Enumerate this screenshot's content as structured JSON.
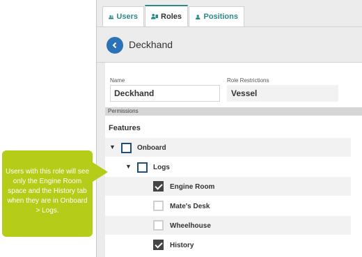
{
  "tabs": [
    {
      "label": "Users",
      "icon": "users-icon"
    },
    {
      "label": "Roles",
      "icon": "roles-icon"
    },
    {
      "label": "Positions",
      "icon": "person-icon"
    }
  ],
  "active_tab": "Roles",
  "header": {
    "title": "Deckhand",
    "back_icon": "chevron-left-icon"
  },
  "form": {
    "name_label": "Name",
    "name_value": "Deckhand",
    "role_restrictions_label": "Role Restrictions",
    "role_restrictions_value": "Vessel"
  },
  "permissions_label": "Permissions",
  "features_label": "Features",
  "tree": [
    {
      "label": "Onboard",
      "level": 0,
      "expanded": true,
      "checked": false
    },
    {
      "label": "Logs",
      "level": 1,
      "expanded": true,
      "checked": false
    },
    {
      "label": "Engine Room",
      "level": 2,
      "checked": true
    },
    {
      "label": "Mate's Desk",
      "level": 2,
      "checked": false
    },
    {
      "label": "Wheelhouse",
      "level": 2,
      "checked": false
    },
    {
      "label": "History",
      "level": 2,
      "checked": true
    }
  ],
  "callout": {
    "text": "Users with this role will see only the Engine Room space and the History tab when they are in Onboard > Logs."
  },
  "colors": {
    "accent": "#2a8a8a",
    "back_button": "#2b73b6",
    "callout": "#b5cc18",
    "checkbox_border": "#1f4e79"
  }
}
